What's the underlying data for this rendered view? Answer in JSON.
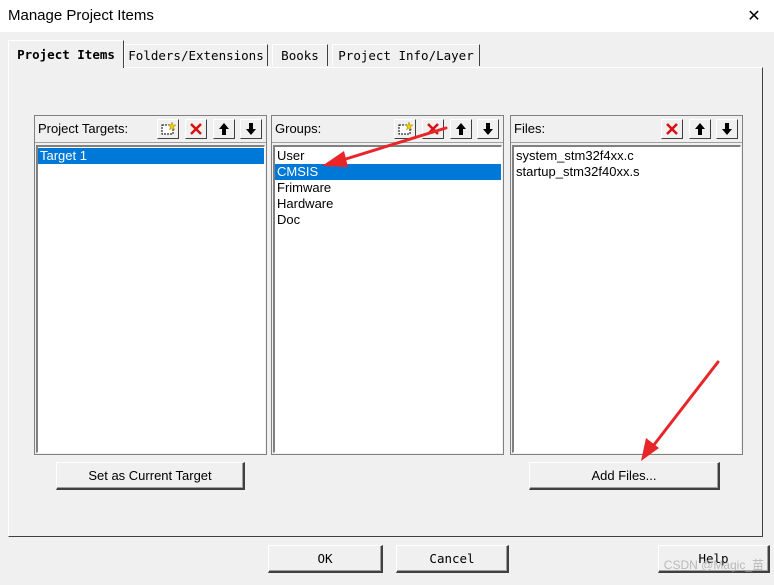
{
  "window": {
    "title": "Manage Project Items",
    "close_symbol": "✕"
  },
  "tabs": [
    {
      "label": "Project Items",
      "active": true
    },
    {
      "label": "Folders/Extensions",
      "active": false
    },
    {
      "label": "Books",
      "active": false
    },
    {
      "label": "Project Info/Layer",
      "active": false
    }
  ],
  "targets": {
    "label": "Project Targets:",
    "items": [
      "Target 1"
    ],
    "selected": 0
  },
  "groups": {
    "label": "Groups:",
    "items": [
      "User",
      "CMSIS",
      "Frimware",
      "Hardware",
      "Doc"
    ],
    "selected": 1
  },
  "files": {
    "label": "Files:",
    "items": [
      "system_stm32f4xx.c",
      "startup_stm32f40xx.s"
    ]
  },
  "buttons": {
    "set_current": "Set as Current Target",
    "add_files": "Add Files...",
    "ok": "OK",
    "cancel": "Cancel",
    "help": "Help"
  },
  "watermark": "CSDN @Magic_苗",
  "colors": {
    "selection": "#0078d7",
    "annotation_arrow": "#e8262a"
  }
}
